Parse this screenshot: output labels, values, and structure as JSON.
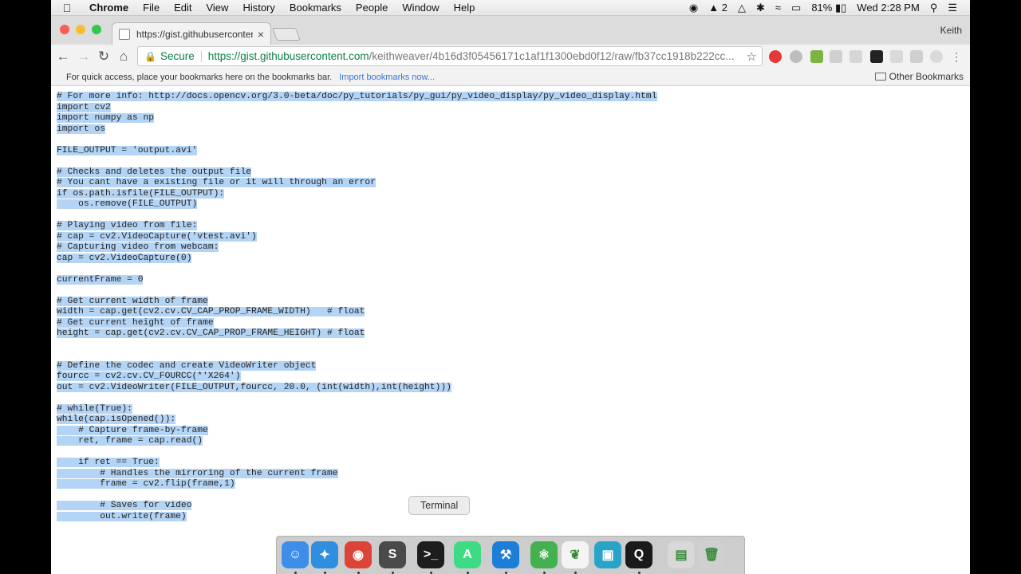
{
  "menubar": {
    "app": "Chrome",
    "menus": [
      "File",
      "Edit",
      "View",
      "History",
      "Bookmarks",
      "People",
      "Window",
      "Help"
    ],
    "status": {
      "adobe_count": "2",
      "battery": "81%",
      "datetime": "Wed 2:28 PM"
    }
  },
  "tab": {
    "title": "https://gist.githubusercontent.",
    "close": "×"
  },
  "profile": "Keith",
  "omnibox": {
    "secure_label": "Secure",
    "url_base": "https://gist.githubusercontent.com",
    "url_path": "/keithweaver/4b16d3f05456171c1af1f1300ebd0f12/raw/fb37cc1918b222cc..."
  },
  "bookmarks": {
    "hint": "For quick access, place your bookmarks here on the bookmarks bar.",
    "import": "Import bookmarks now...",
    "other": "Other Bookmarks"
  },
  "code_lines": [
    "# For more info: http://docs.opencv.org/3.0-beta/doc/py_tutorials/py_gui/py_video_display/py_video_display.html",
    "import cv2",
    "import numpy as np",
    "import os",
    "",
    "FILE_OUTPUT = 'output.avi'",
    "",
    "# Checks and deletes the output file",
    "# You cant have a existing file or it will through an error",
    "if os.path.isfile(FILE_OUTPUT):",
    "    os.remove(FILE_OUTPUT)",
    "",
    "# Playing video from file:",
    "# cap = cv2.VideoCapture('vtest.avi')",
    "# Capturing video from webcam:",
    "cap = cv2.VideoCapture(0)",
    "",
    "currentFrame = 0",
    "",
    "# Get current width of frame",
    "width = cap.get(cv2.cv.CV_CAP_PROP_FRAME_WIDTH)   # float",
    "# Get current height of frame",
    "height = cap.get(cv2.cv.CV_CAP_PROP_FRAME_HEIGHT) # float",
    "",
    "",
    "# Define the codec and create VideoWriter object",
    "fourcc = cv2.cv.CV_FOURCC(*'X264')",
    "out = cv2.VideoWriter(FILE_OUTPUT,fourcc, 20.0, (int(width),int(height)))",
    "",
    "# while(True):",
    "while(cap.isOpened()):",
    "    # Capture frame-by-frame",
    "    ret, frame = cap.read()",
    "",
    "    if ret == True:",
    "        # Handles the mirroring of the current frame",
    "        frame = cv2.flip(frame,1)",
    "",
    "        # Saves for video",
    "        out.write(frame)"
  ],
  "dock": {
    "tooltip": "Terminal",
    "apps": [
      {
        "name": "Finder",
        "icon": "finder-icon",
        "color": "#3d8ee8",
        "glyph": "☺"
      },
      {
        "name": "Safari",
        "icon": "safari-icon",
        "color": "#2f8ee0",
        "glyph": "✦"
      },
      {
        "name": "Chrome",
        "icon": "chrome-icon",
        "color": "#db4437",
        "glyph": "◉"
      },
      {
        "name": "Sublime Text",
        "icon": "sublime-icon",
        "color": "#4a4a4a",
        "glyph": "S"
      },
      {
        "name": "Terminal",
        "icon": "terminal-icon",
        "color": "#1d1d1d",
        "glyph": ">_"
      },
      {
        "name": "Android Studio",
        "icon": "android-studio-icon",
        "color": "#3ddc84",
        "glyph": "A"
      },
      {
        "name": "Xcode",
        "icon": "xcode-icon",
        "color": "#1c7ed6",
        "glyph": "⚒"
      },
      {
        "name": "Atom",
        "icon": "atom-icon",
        "color": "#45b04f",
        "glyph": "⚛"
      },
      {
        "name": "MongoDB",
        "icon": "mongodb-icon",
        "color": "#f4f4f4",
        "glyph": "❦"
      },
      {
        "name": "Preview",
        "icon": "preview-icon",
        "color": "#2aa3c9",
        "glyph": "▣"
      },
      {
        "name": "QuickTime",
        "icon": "quicktime-icon",
        "color": "#1a1a1a",
        "glyph": "Q"
      },
      {
        "name": "Documents",
        "icon": "documents-icon",
        "color": "#d8d8d8",
        "glyph": "▤"
      },
      {
        "name": "Trash",
        "icon": "trash-icon",
        "color": "#cfcfcf",
        "glyph": "🗑"
      }
    ]
  }
}
